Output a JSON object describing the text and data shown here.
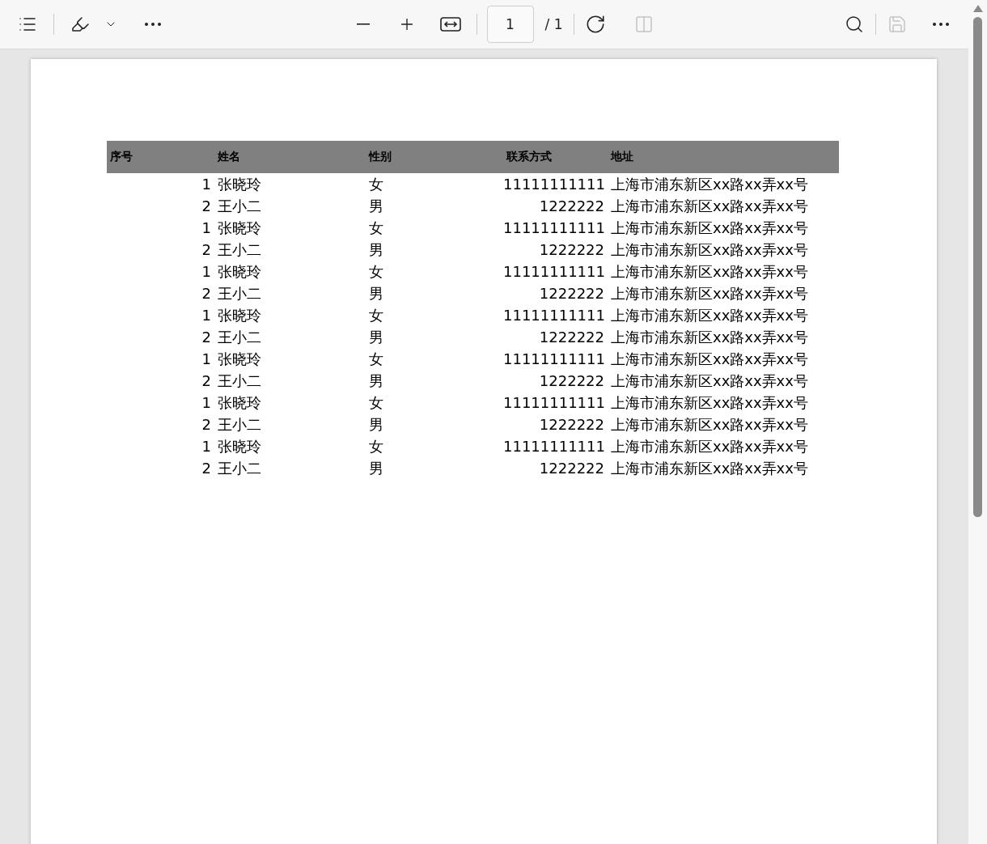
{
  "toolbar": {
    "left": [
      {
        "kind": "contents",
        "disabled": false
      },
      {
        "kind": "draw",
        "disabled": false
      },
      {
        "kind": "dropdown",
        "disabled": false
      },
      {
        "kind": "more",
        "disabled": false
      }
    ],
    "zoom": [
      {
        "kind": "zoom-out",
        "disabled": false
      },
      {
        "kind": "zoom-in",
        "disabled": false
      },
      {
        "kind": "fit",
        "disabled": false
      }
    ],
    "page_input": {
      "value": "1"
    },
    "page_total": "/ 1",
    "view": [
      {
        "kind": "rotate",
        "disabled": false
      },
      {
        "kind": "two-page",
        "disabled": true
      }
    ],
    "right": [
      {
        "kind": "search",
        "disabled": false
      },
      {
        "kind": "save",
        "disabled": true
      },
      {
        "kind": "more",
        "disabled": false
      }
    ]
  },
  "table": {
    "columns": [
      "序号",
      "姓名",
      "性别",
      "联系方式",
      "地址"
    ],
    "rows": [
      [
        "1",
        "张晓玲",
        "女",
        "11111111111",
        "上海市浦东新区xx路xx弄xx号"
      ],
      [
        "2",
        "王小二",
        "男",
        "1222222",
        "上海市浦东新区xx路xx弄xx号"
      ],
      [
        "1",
        "张晓玲",
        "女",
        "11111111111",
        "上海市浦东新区xx路xx弄xx号"
      ],
      [
        "2",
        "王小二",
        "男",
        "1222222",
        "上海市浦东新区xx路xx弄xx号"
      ],
      [
        "1",
        "张晓玲",
        "女",
        "11111111111",
        "上海市浦东新区xx路xx弄xx号"
      ],
      [
        "2",
        "王小二",
        "男",
        "1222222",
        "上海市浦东新区xx路xx弄xx号"
      ],
      [
        "1",
        "张晓玲",
        "女",
        "11111111111",
        "上海市浦东新区xx路xx弄xx号"
      ],
      [
        "2",
        "王小二",
        "男",
        "1222222",
        "上海市浦东新区xx路xx弄xx号"
      ],
      [
        "1",
        "张晓玲",
        "女",
        "11111111111",
        "上海市浦东新区xx路xx弄xx号"
      ],
      [
        "2",
        "王小二",
        "男",
        "1222222",
        "上海市浦东新区xx路xx弄xx号"
      ],
      [
        "1",
        "张晓玲",
        "女",
        "11111111111",
        "上海市浦东新区xx路xx弄xx号"
      ],
      [
        "2",
        "王小二",
        "男",
        "1222222",
        "上海市浦东新区xx路xx弄xx号"
      ],
      [
        "1",
        "张晓玲",
        "女",
        "11111111111",
        "上海市浦东新区xx路xx弄xx号"
      ],
      [
        "2",
        "王小二",
        "男",
        "1222222",
        "上海市浦东新区xx路xx弄xx号"
      ]
    ]
  }
}
